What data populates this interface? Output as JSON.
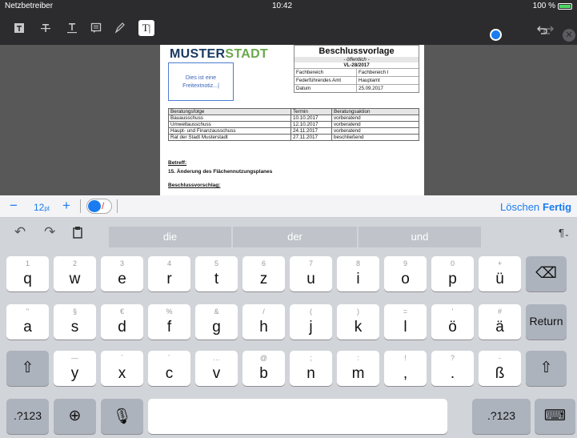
{
  "status": {
    "carrier": "Netzbetreiber",
    "time": "10:42",
    "battery": "100 %"
  },
  "toolbar": {
    "tools": [
      "text-box-icon",
      "strikethrough-icon",
      "underline-icon",
      "note-icon",
      "pen-icon",
      "text-cursor-icon"
    ],
    "active_tool": "T|"
  },
  "document": {
    "logo_a": "MUSTER",
    "logo_b": "STADT",
    "heading": "Beschlussvorlage",
    "visibility": "- öffentlich -",
    "number": "VL-28/2017",
    "meta": [
      [
        "Fachbereich",
        "Fachbereich I"
      ],
      [
        "Federführendes Amt",
        "Hauptamt"
      ],
      [
        "Datum",
        "25.09.2017"
      ]
    ],
    "note_line1": "Dies ist eine",
    "note_line2": "Freitextnotiz...|",
    "table_headers": [
      "Beratungsfolge",
      "Termin",
      "Beratungsaktion"
    ],
    "table_rows": [
      [
        "Bauausschuss",
        "10.10.2017",
        "vorberatend"
      ],
      [
        "Umweltausschuss",
        "12.10.2017",
        "vorberatend"
      ],
      [
        "Haupt- und Finanzausschuss",
        "24.11.2017",
        "vorberatend"
      ],
      [
        "Rat der Stadt Musterstadt",
        "27.11.2017",
        "beschließend"
      ]
    ],
    "betreff_label": "Betreff:",
    "betreff_text": "15. Änderung des Flächennutzungsplanes",
    "beschluss_label": "Beschlussvorschlag:"
  },
  "format_bar": {
    "minus": "−",
    "font_size": "12",
    "font_size_unit": "pt",
    "plus": "+",
    "delete_label": "Löschen",
    "done_label": "Fertig",
    "color": "#1a7cf0"
  },
  "suggestions": [
    "die",
    "der",
    "und"
  ],
  "para_icon": "¶",
  "keys": {
    "row1": [
      [
        "1",
        "q"
      ],
      [
        "2",
        "w"
      ],
      [
        "3",
        "e"
      ],
      [
        "4",
        "r"
      ],
      [
        "5",
        "t"
      ],
      [
        "6",
        "z"
      ],
      [
        "7",
        "u"
      ],
      [
        "8",
        "i"
      ],
      [
        "9",
        "o"
      ],
      [
        "0",
        "p"
      ],
      [
        "+",
        "ü"
      ]
    ],
    "row2": [
      [
        "\"",
        "a"
      ],
      [
        "§",
        "s"
      ],
      [
        "€",
        "d"
      ],
      [
        "%",
        "f"
      ],
      [
        "&",
        "g"
      ],
      [
        "/",
        "h"
      ],
      [
        "(",
        "j"
      ],
      [
        ")",
        "k"
      ],
      [
        "=",
        "l"
      ],
      [
        "'",
        "ö"
      ],
      [
        "#",
        "ä"
      ]
    ],
    "row3": [
      [
        "—",
        "y"
      ],
      [
        "`",
        "x"
      ],
      [
        "´",
        "c"
      ],
      [
        "…",
        "v"
      ],
      [
        "@",
        "b"
      ],
      [
        ";",
        "n"
      ],
      [
        ":",
        "m"
      ],
      [
        "!",
        ","
      ],
      [
        "?",
        "."
      ],
      [
        "-",
        "ß"
      ]
    ],
    "return_label": "Return",
    "numbers_label": ".?123"
  }
}
